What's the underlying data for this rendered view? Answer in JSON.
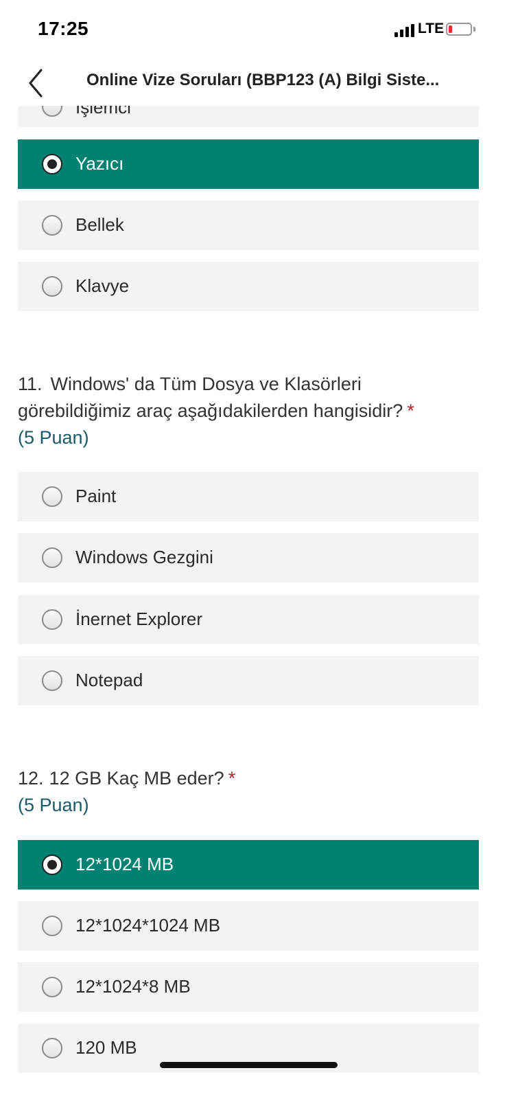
{
  "status_bar": {
    "time": "17:25",
    "network": "LTE"
  },
  "nav": {
    "title": "Online Vize Soruları (BBP123 (A) Bilgi Siste..."
  },
  "q10": {
    "options": [
      {
        "label": "İşlemci",
        "selected": false
      },
      {
        "label": "Yazıcı",
        "selected": true
      },
      {
        "label": "Bellek",
        "selected": false
      },
      {
        "label": "Klavye",
        "selected": false
      }
    ]
  },
  "q11": {
    "number": "11.",
    "text_line1": "Windows' da Tüm Dosya ve Klasörleri",
    "text_line2": "görebildiğimiz araç aşağıdakilerden hangisidir?",
    "required_mark": "*",
    "points": "(5 Puan)",
    "options": [
      {
        "label": "Paint",
        "selected": false
      },
      {
        "label": "Windows Gezgini",
        "selected": false
      },
      {
        "label": "İnernet Explorer",
        "selected": false
      },
      {
        "label": "Notepad",
        "selected": false
      }
    ]
  },
  "q12": {
    "number": "12.",
    "text": "12 GB Kaç MB eder?",
    "required_mark": "*",
    "points": "(5 Puan)",
    "options": [
      {
        "label": "12*1024 MB",
        "selected": true
      },
      {
        "label": "12*1024*1024 MB",
        "selected": false
      },
      {
        "label": "12*1024*8 MB",
        "selected": false
      },
      {
        "label": "120 MB",
        "selected": false
      }
    ]
  },
  "colors": {
    "selected": "#008272",
    "option_bg": "#f3f3f3",
    "required": "#a4262c",
    "points": "#1c5a6a"
  }
}
